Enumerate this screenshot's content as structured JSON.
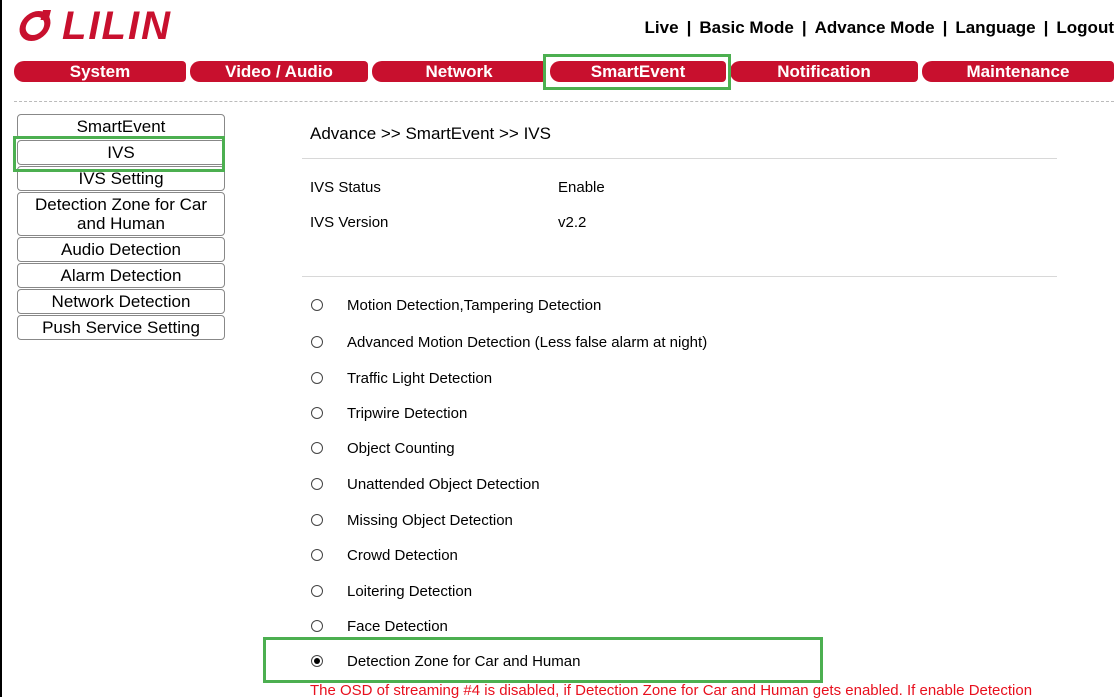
{
  "brand": {
    "logo_text": "LILIN",
    "brand_color": "#c8102e"
  },
  "topnav": {
    "items": [
      {
        "label": "Live"
      },
      {
        "label": "Basic Mode"
      },
      {
        "label": "Advance Mode"
      },
      {
        "label": "Language"
      },
      {
        "label": "Logout"
      }
    ],
    "separator": "|"
  },
  "tabs": [
    {
      "label": "System"
    },
    {
      "label": "Video / Audio"
    },
    {
      "label": "Network"
    },
    {
      "label": "SmartEvent",
      "active": true
    },
    {
      "label": "Notification"
    },
    {
      "label": "Maintenance"
    }
  ],
  "sidebar": {
    "items": [
      {
        "label": "SmartEvent"
      },
      {
        "label": "IVS",
        "selected": true
      },
      {
        "label": "IVS Setting"
      },
      {
        "label": "Detection Zone for Car and Human"
      },
      {
        "label": "Audio Detection"
      },
      {
        "label": "Alarm Detection"
      },
      {
        "label": "Network Detection"
      },
      {
        "label": "Push Service Setting"
      }
    ]
  },
  "main": {
    "breadcrumb": "Advance >> SmartEvent >> IVS",
    "info": {
      "status_label": "IVS Status",
      "status_value": "Enable",
      "version_label": "IVS Version",
      "version_value": "v2.2"
    },
    "options": [
      {
        "label": "Motion Detection,Tampering Detection",
        "checked": false
      },
      {
        "label": "Advanced Motion Detection (Less false alarm at night)",
        "checked": false
      },
      {
        "label": "Traffic Light Detection",
        "checked": false
      },
      {
        "label": "Tripwire Detection",
        "checked": false
      },
      {
        "label": "Object Counting",
        "checked": false
      },
      {
        "label": "Unattended Object Detection",
        "checked": false
      },
      {
        "label": "Missing Object Detection",
        "checked": false
      },
      {
        "label": "Crowd Detection",
        "checked": false
      },
      {
        "label": "Loitering Detection",
        "checked": false
      },
      {
        "label": "Face Detection",
        "checked": false
      },
      {
        "label": "Detection Zone for Car and Human",
        "checked": true
      }
    ],
    "warning": "The OSD of streaming #4 is disabled, if Detection Zone for Car and Human gets enabled. If enable Detection"
  },
  "colors": {
    "highlight": "#4caf50",
    "warning": "#e8101e"
  }
}
